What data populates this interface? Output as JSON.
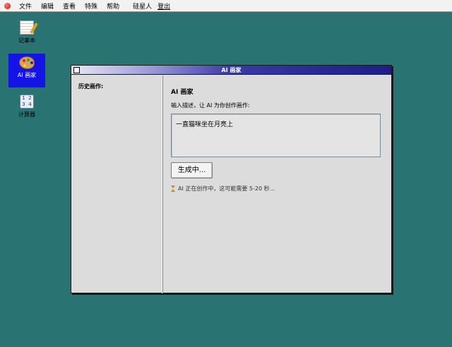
{
  "menubar": {
    "items": [
      "文件",
      "编辑",
      "查看",
      "特殊",
      "帮助"
    ],
    "user": "硅星人",
    "logout": "登出"
  },
  "desktop": {
    "icons": [
      {
        "label": "记事本",
        "icon": "notepad-icon"
      },
      {
        "label": "AI 画家",
        "icon": "palette-icon"
      },
      {
        "label": "计算器",
        "icon": "calculator-icon"
      }
    ],
    "calc_glyphs": [
      "1",
      "2",
      "3",
      "4"
    ]
  },
  "window": {
    "title": "AI 画家",
    "sidebar_title": "历史画作:",
    "content_title": "AI 画家",
    "description": "输入描述，让 AI 为你创作画作:",
    "prompt_value": "一直猫咪坐在月亮上",
    "button_label": "生成中...",
    "status": "AI 正在创作中，这可能需要 5-20 秒..."
  },
  "colors": {
    "desktop": "#2a7373",
    "selection": "#1414e6",
    "title_gradient_end": "#1e1e8a"
  }
}
